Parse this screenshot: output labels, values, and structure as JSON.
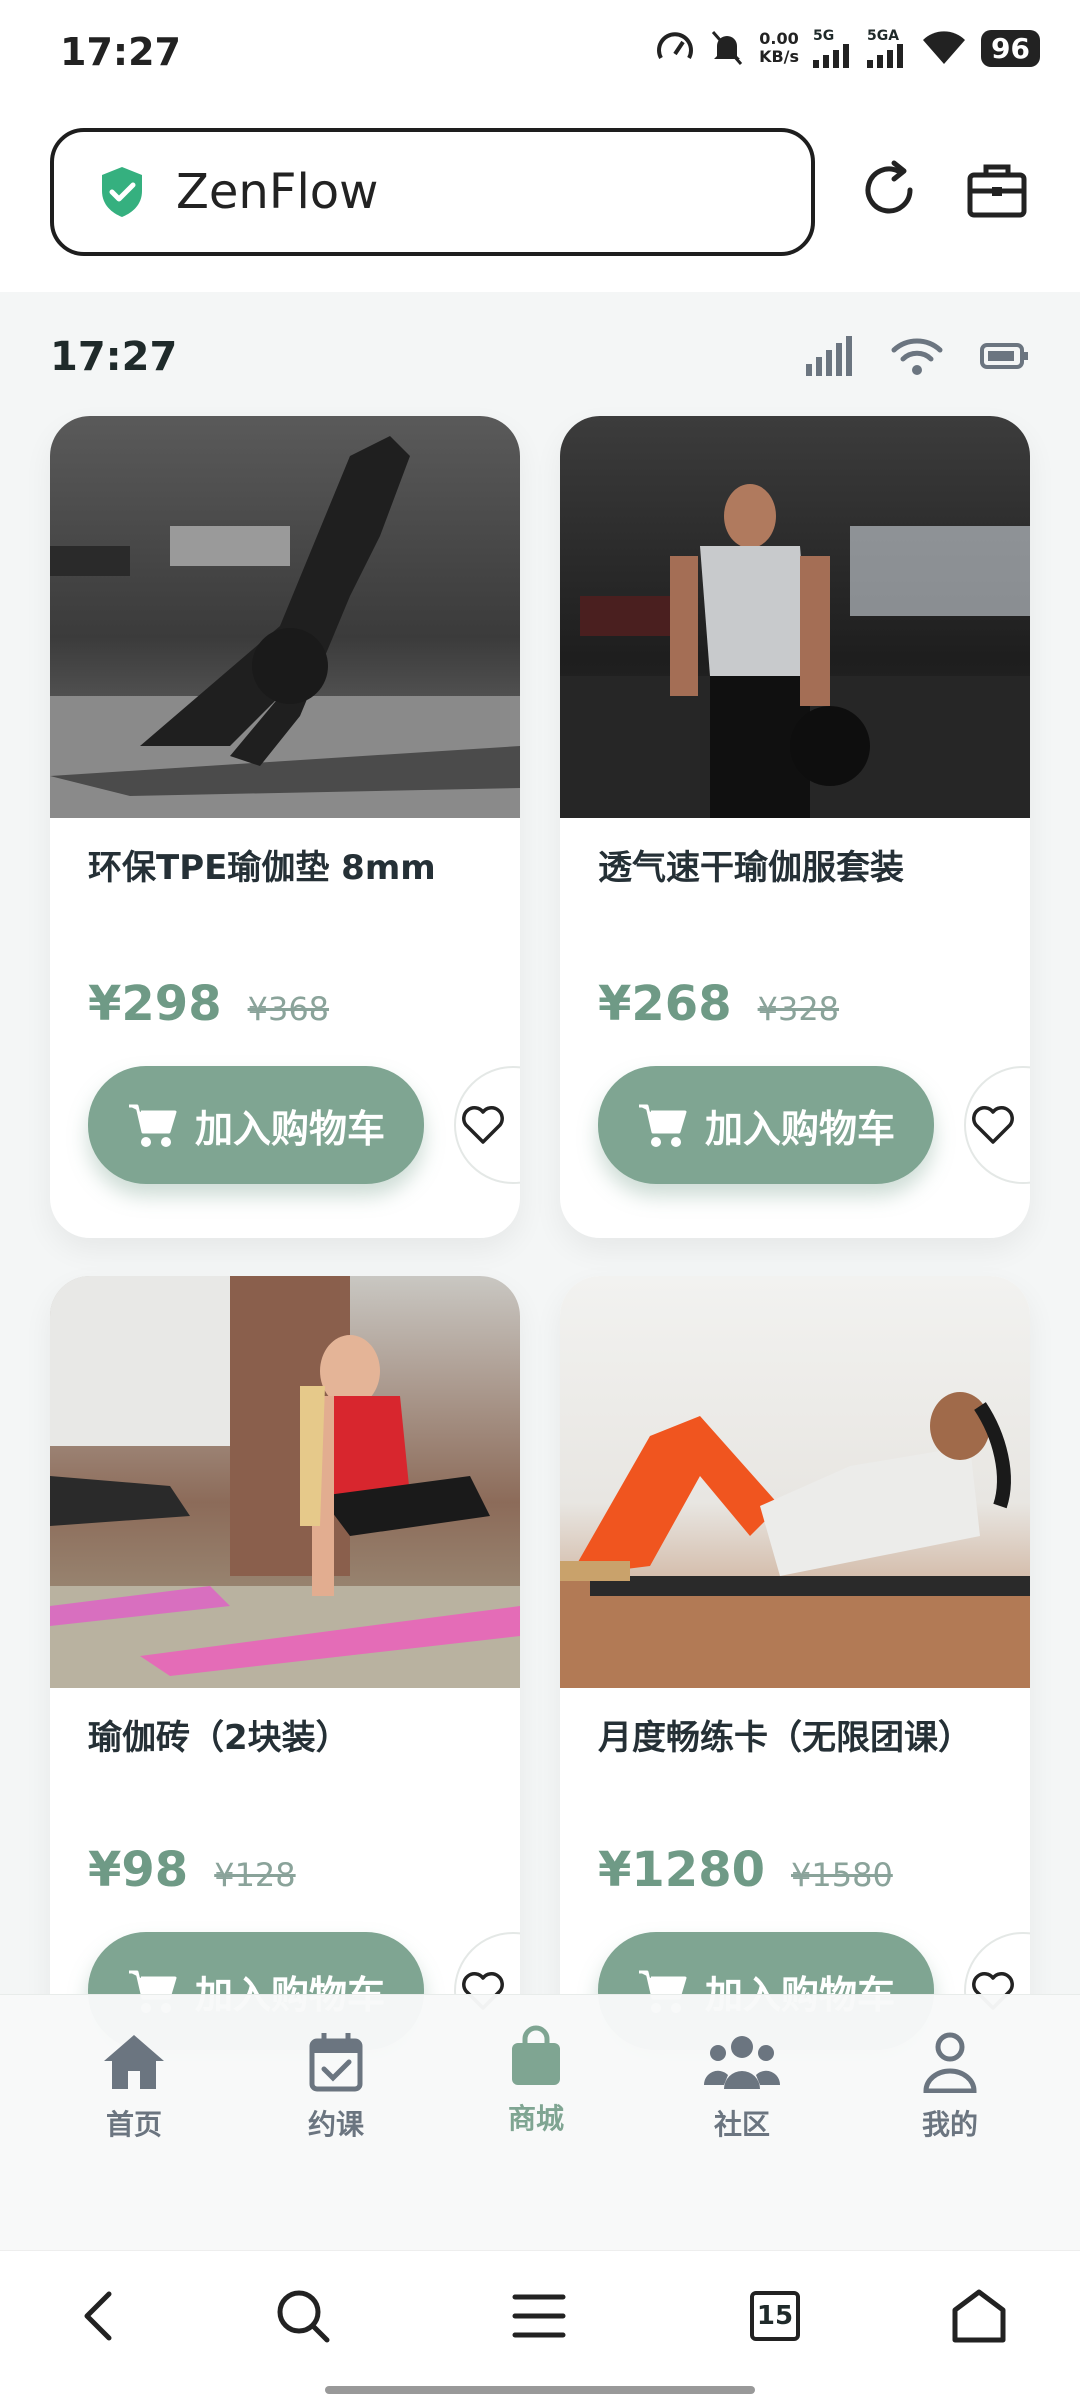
{
  "system": {
    "time": "17:27",
    "net_speed_value": "0.00",
    "net_speed_unit": "KB/s",
    "sim1": "5G",
    "sim2": "5GA",
    "battery": "96"
  },
  "browser": {
    "url_title": "ZenFlow",
    "tab_count": "15"
  },
  "app_status": {
    "time": "17:27"
  },
  "products": [
    {
      "title": "环保TPE瑜伽垫 8mm",
      "price": "¥298",
      "old_price": "¥368",
      "cart_label": "加入购物车"
    },
    {
      "title": "透气速干瑜伽服套装",
      "price": "¥268",
      "old_price": "¥328",
      "cart_label": "加入购物车"
    },
    {
      "title": "瑜伽砖（2块装）",
      "price": "¥98",
      "old_price": "¥128",
      "cart_label": "加入购物车"
    },
    {
      "title": "月度畅练卡（无限团课）",
      "price": "¥1280",
      "old_price": "¥1580",
      "cart_label": "加入购物车"
    }
  ],
  "nav": {
    "items": [
      {
        "label": "首页",
        "icon": "home-icon"
      },
      {
        "label": "约课",
        "icon": "calendar-check-icon"
      },
      {
        "label": "商城",
        "icon": "shopping-bag-icon",
        "active": true
      },
      {
        "label": "社区",
        "icon": "users-icon"
      },
      {
        "label": "我的",
        "icon": "user-icon"
      }
    ]
  },
  "colors": {
    "accent": "#7fa592",
    "price": "#6f9a86",
    "text": "#253036",
    "background": "#f4f6f6"
  }
}
